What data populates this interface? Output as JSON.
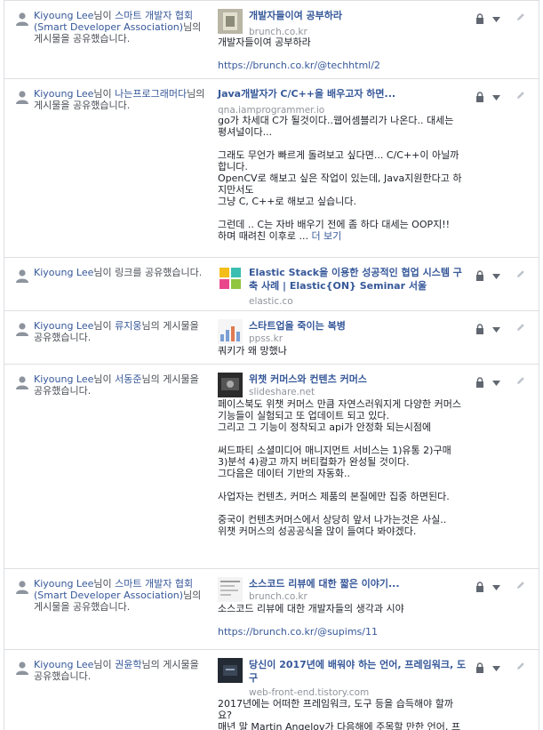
{
  "feed": {
    "items": [
      {
        "actor": "Kiyoung Lee",
        "verb_pre": "님이 ",
        "source": "스마트 개발자 협회(Smart Developer Association)",
        "verb_post": "님의 게시물을 공유했습니다.",
        "thumb_icon": "photo-thumbnail",
        "title": "개발자들이여 공부하라",
        "domain": "brunch.co.kr",
        "body": "개발자들이여 공부하라\n\n",
        "link": "https://brunch.co.kr/@techhtml/2"
      },
      {
        "actor": "Kiyoung Lee",
        "verb_pre": "님이 ",
        "source": "나는프로그래머다",
        "verb_post": "님의 게시물을 공유했습니다.",
        "thumb_icon": "",
        "title": "Java개발자가 C/C++을 배우고자 하면...",
        "domain": "qna.iamprogrammer.io",
        "body": "go가 차세대 C가 될것이다..웹어셈블리가 나온다.. 대세는 평셔널이다...\n\n그래도 무언가 빠르게 돌려보고 싶다면... C/C++이 아닐까 합니다.\nOpenCV로 해보고 싶은 작업이 있는데, Java지원한다고 하지만서도\n그냥 C, C++로 해보고 싶습니다.\n\n그런데 .. C는 자바 배우기 전에 좀 하다 대세는 OOP지!!\n하며 때려친 이후로 ... ",
        "see_more": "더 보기"
      },
      {
        "actor": "Kiyoung Lee",
        "verb_pre": "님이 ",
        "source": "",
        "verb_post": "링크를 공유했습니다.",
        "thumb_icon": "elastic-logo",
        "title": "Elastic Stack을 이용한 성공적인 협업 시스템 구축 사례 | Elastic{ON} Seminar 서울",
        "domain": "elastic.co"
      },
      {
        "actor": "Kiyoung Lee",
        "verb_pre": "님이 ",
        "source": "류지웅",
        "verb_post": "님의 게시물을 공유했습니다.",
        "thumb_icon": "chart-thumbnail",
        "title": "스타트업을 죽이는 복병",
        "domain": "ppss.kr",
        "body": "쿼키가 왜 망했나"
      },
      {
        "actor": "Kiyoung Lee",
        "verb_pre": "님이 ",
        "source": "서동준",
        "verb_post": "님의 게시물을 공유했습니다.",
        "thumb_icon": "slide-thumbnail",
        "title": "위챗 커머스와 컨텐츠 커머스",
        "domain": "slideshare.net",
        "body": "페이스북도 위챗 커머스 만큼 자연스러워지게 다양한 커머스 기능들이 실험되고 또 업데이트 되고 있다.\n그리고 그 기능이 정착되고 api가 안정화 되는시점에\n\n써드파티 소셜미디어 매니지먼트 서비스는 1)유통 2)구매 3)분석 4)광고 까지 버티컬화가 완성될 것이다.\n그다음은 데이터 기반의 자동화..\n\n사업자는 컨텐츠, 커머스 제품의 본질에만 집중 하면된다.\n\n중국이 컨텐츠커머스에서 상당히 앞서 나가는것은 사실..\n위챗 커머스의 성공공식을 많이 들여다 봐야겠다."
      },
      {
        "actor": "Kiyoung Lee",
        "verb_pre": "님이 ",
        "source": "스마트 개발자 협회(Smart Developer Association)",
        "verb_post": "님의 게시물을 공유했습니다.",
        "thumb_icon": "code-thumbnail",
        "title": "소스코드 리뷰에 대한 짧은 이야기...",
        "domain": "brunch.co.kr",
        "body": "소스코드 리뷰에 대한 개발자들의 생각과 시야\n\n",
        "link": "https://brunch.co.kr/@supims/11"
      },
      {
        "actor": "Kiyoung Lee",
        "verb_pre": "님이 ",
        "source": "권윤학",
        "verb_post": "님의 게시물을 공유했습니다.",
        "thumb_icon": "dark-thumbnail",
        "title": "당신이 2017년에 배워야 하는 언어, 프레임워크, 도구",
        "domain": "web-front-end.tistory.com",
        "body": "2017년에는 어떠한 프레임워크, 도구 등을 습득해야 할까요?\n매년 말 Martin Angelov가 다음해에 주목할 만한 언어, 프"
      }
    ]
  }
}
